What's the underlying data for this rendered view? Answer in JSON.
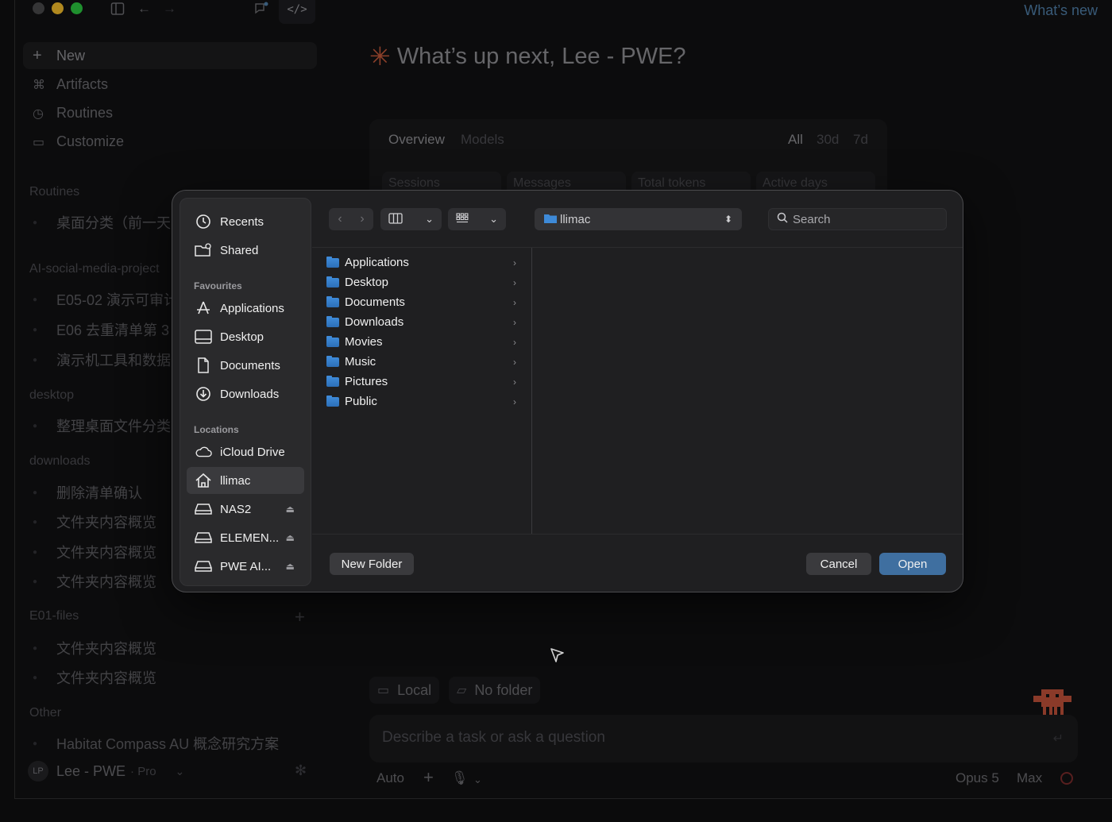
{
  "app": {
    "whats_new": "What’s new",
    "sidebar": {
      "new_label": "New",
      "nav": [
        {
          "label": "Artifacts",
          "icon": "artifacts-icon"
        },
        {
          "label": "Routines",
          "icon": "clock-icon"
        },
        {
          "label": "Customize",
          "icon": "briefcase-icon"
        }
      ],
      "groups": [
        {
          "title": "Routines",
          "items": [
            "桌面分类（前一天"
          ]
        },
        {
          "title": "AI-social-media-project",
          "items": [
            "E05-02 演示可审计",
            "E06 去重清单第 3",
            "演示机工具和数据"
          ]
        },
        {
          "title": "desktop",
          "items": [
            "整理桌面文件分类"
          ]
        },
        {
          "title": "downloads",
          "items": [
            "删除清单确认",
            "文件夹内容概览",
            "文件夹内容概览",
            "文件夹内容概览"
          ]
        },
        {
          "title": "E01-files",
          "items": [
            "文件夹内容概览",
            "文件夹内容概览"
          ]
        },
        {
          "title": "Other",
          "items": [
            "Habitat Compass AU 概念研究方案"
          ]
        }
      ],
      "user": {
        "initials": "LP",
        "name": "Lee - PWE",
        "plan": "· Pro"
      }
    },
    "main": {
      "greeting": "What’s up next, Lee - PWE?",
      "card": {
        "tabs": [
          "Overview",
          "Models"
        ],
        "ranges": [
          "All",
          "30d",
          "7d"
        ],
        "stats": [
          "Sessions",
          "Messages",
          "Total tokens",
          "Active days"
        ]
      },
      "pills": [
        {
          "label": "Local",
          "icon": "laptop-icon"
        },
        {
          "label": "No folder",
          "icon": "folder-icon"
        }
      ],
      "composer_placeholder": "Describe a task or ask a question",
      "bottom": {
        "mode": "Auto",
        "model": "Opus 5",
        "effort": "Max"
      }
    }
  },
  "dialog": {
    "sidebar": {
      "top": [
        {
          "label": "Recents",
          "icon": "clock-icon"
        },
        {
          "label": "Shared",
          "icon": "shared-folder-icon"
        }
      ],
      "favourites_title": "Favourites",
      "favourites": [
        {
          "label": "Applications",
          "icon": "applications-icon"
        },
        {
          "label": "Desktop",
          "icon": "desktop-icon"
        },
        {
          "label": "Documents",
          "icon": "document-icon"
        },
        {
          "label": "Downloads",
          "icon": "download-icon"
        }
      ],
      "locations_title": "Locations",
      "locations": [
        {
          "label": "iCloud Drive",
          "icon": "cloud-icon"
        },
        {
          "label": "llimac",
          "icon": "home-icon",
          "selected": true
        },
        {
          "label": "NAS2",
          "icon": "drive-icon",
          "eject": true
        },
        {
          "label": "ELEMEN...",
          "icon": "drive-icon",
          "eject": true
        },
        {
          "label": "PWE AI...",
          "icon": "drive-icon",
          "eject": true
        }
      ]
    },
    "path_label": "llimac",
    "search_placeholder": "Search",
    "folders": [
      "Applications",
      "Desktop",
      "Documents",
      "Downloads",
      "Movies",
      "Music",
      "Pictures",
      "Public"
    ],
    "buttons": {
      "new_folder": "New Folder",
      "cancel": "Cancel",
      "open": "Open"
    }
  },
  "colors": {
    "accent": "#3f6fa0",
    "brand": "#c4593b"
  }
}
